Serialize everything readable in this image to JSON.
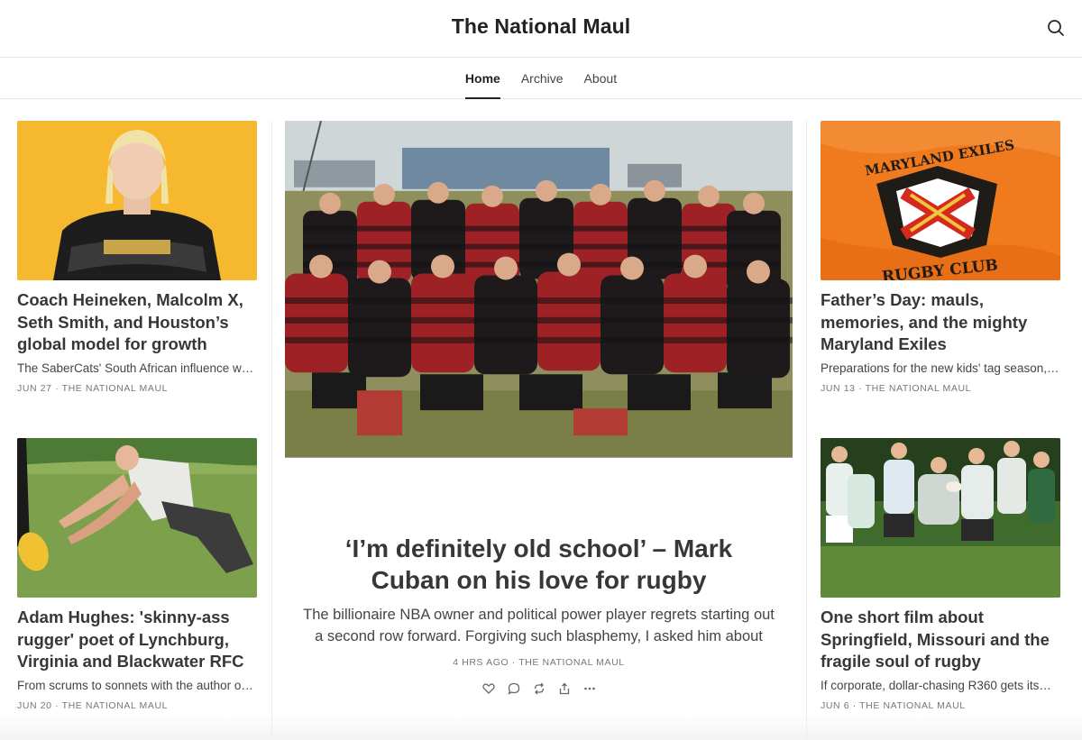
{
  "site": {
    "title": "The National Maul"
  },
  "nav": {
    "items": [
      "Home",
      "Archive",
      "About"
    ],
    "active": "Home"
  },
  "featured": {
    "title": "‘I’m definitely old school’ – Mark Cuban on his love for rugby",
    "subtitle": "The billionaire NBA owner and political power player regrets starting out a second row forward. Forgiving such blasphemy, I asked him about his…",
    "date": "4 HRS AGO",
    "author": "THE NATIONAL MAUL"
  },
  "posts": [
    {
      "title": "Coach Heineken, Malcolm X, Seth Smith, and Houston’s global model for growth",
      "subtitle": "The SaberCats' South African influence w…",
      "date": "JUN 27",
      "author": "THE NATIONAL MAUL"
    },
    {
      "title": "Father’s Day: mauls, memories, and the mighty Maryland Exiles",
      "subtitle": "Preparations for the new kids' tag season,…",
      "date": "JUN 13",
      "author": "THE NATIONAL MAUL"
    },
    {
      "title": "Adam Hughes: 'skinny-ass rugger' poet of Lynchburg, Virginia and Blackwater RFC",
      "subtitle": "From scrums to sonnets with the author o…",
      "date": "JUN 20",
      "author": "THE NATIONAL MAUL"
    },
    {
      "title": "One short film about Springfield, Missouri and the fragile soul of rugby",
      "subtitle": "If corporate, dollar-chasing R360 gets its…",
      "date": "JUN 6",
      "author": "THE NATIONAL MAUL"
    }
  ],
  "logo_text": {
    "top": "MARYLAND EXILES",
    "bottom": "RUGBY CLUB"
  },
  "meta_separator": " · "
}
